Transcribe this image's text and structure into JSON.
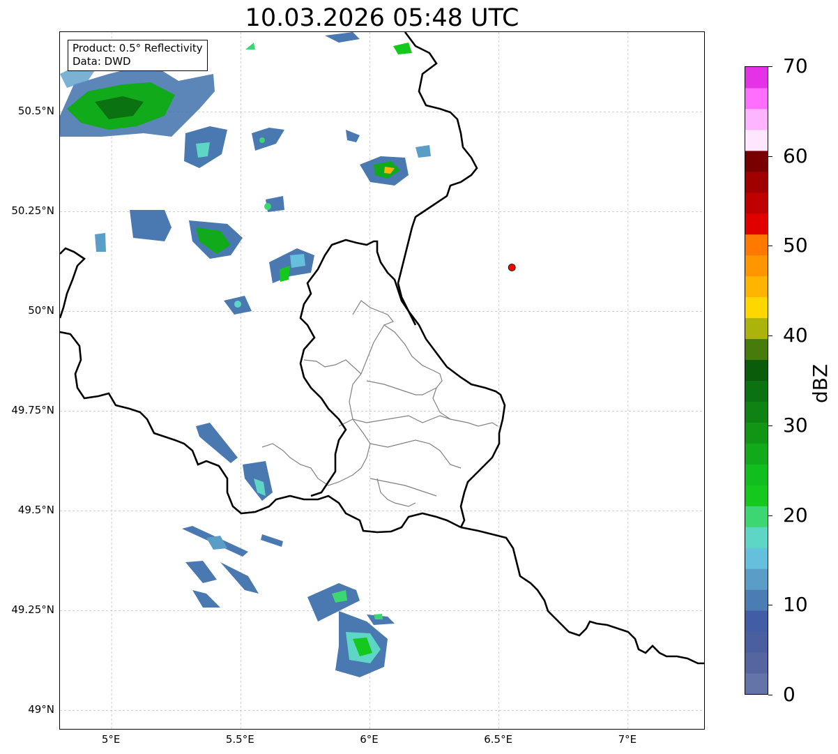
{
  "title": "10.03.2026 05:48 UTC",
  "info_box": {
    "product": "Product: 0.5° Reflectivity",
    "data": "Data: DWD"
  },
  "map": {
    "extent": {
      "lon_min": 4.8,
      "lon_max": 7.3,
      "lat_min": 48.95,
      "lat_max": 50.7
    },
    "lat_ticks": [
      {
        "value": 50.5,
        "label": "50.5°N"
      },
      {
        "value": 50.25,
        "label": "50.25°N"
      },
      {
        "value": 50.0,
        "label": "50°N"
      },
      {
        "value": 49.75,
        "label": "49.75°N"
      },
      {
        "value": 49.5,
        "label": "49.5°N"
      },
      {
        "value": 49.25,
        "label": "49.25°N"
      },
      {
        "value": 49.0,
        "label": "49°N"
      }
    ],
    "lon_ticks": [
      {
        "value": 5.0,
        "label": "5°E"
      },
      {
        "value": 5.5,
        "label": "5.5°E"
      },
      {
        "value": 6.0,
        "label": "6°E"
      },
      {
        "value": 6.5,
        "label": "6.5°E"
      },
      {
        "value": 7.0,
        "label": "7°E"
      }
    ],
    "radar_site": {
      "lon": 6.55,
      "lat": 50.11,
      "color": "#ff0000"
    },
    "gridlines": true
  },
  "colorbar": {
    "unit": "dBZ",
    "min": 0,
    "max": 70,
    "step": 2.5,
    "colors": [
      "#6473a8",
      "#5565a0",
      "#4a5fa0",
      "#425da6",
      "#4c7cb4",
      "#5a9ec8",
      "#64c0dc",
      "#5ed6c6",
      "#3cd672",
      "#14c81e",
      "#10be1e",
      "#10aa1a",
      "#109614",
      "#0e8212",
      "#0a7210",
      "#0a5c0a",
      "#487c0a",
      "#aab40a",
      "#ffd700",
      "#ffb400",
      "#ff9600",
      "#ff7800",
      "#e10000",
      "#c00000",
      "#a00000",
      "#780000",
      "#ffe6ff",
      "#ffb4ff",
      "#ff6eff",
      "#e632e6"
    ],
    "ticks": [
      {
        "value": 0,
        "label": "0"
      },
      {
        "value": 10,
        "label": "10"
      },
      {
        "value": 20,
        "label": "20"
      },
      {
        "value": 30,
        "label": "30"
      },
      {
        "value": 40,
        "label": "40"
      },
      {
        "value": 50,
        "label": "50"
      },
      {
        "value": 60,
        "label": "60"
      },
      {
        "value": 70,
        "label": "70"
      }
    ]
  },
  "echo_areas": [
    {
      "lon": 4.98,
      "lat": 50.52,
      "dbz": 25
    },
    {
      "lon": 5.12,
      "lat": 50.55,
      "dbz": 28
    },
    {
      "lon": 5.25,
      "lat": 50.48,
      "dbz": 20
    },
    {
      "lon": 5.45,
      "lat": 50.42,
      "dbz": 10
    },
    {
      "lon": 5.64,
      "lat": 50.45,
      "dbz": 12
    },
    {
      "lon": 6.07,
      "lat": 50.36,
      "dbz": 35
    },
    {
      "lon": 5.62,
      "lat": 50.27,
      "dbz": 12
    },
    {
      "lon": 5.17,
      "lat": 50.22,
      "dbz": 6
    },
    {
      "lon": 5.42,
      "lat": 50.2,
      "dbz": 25
    },
    {
      "lon": 5.7,
      "lat": 50.13,
      "dbz": 14
    },
    {
      "lon": 5.46,
      "lat": 50.02,
      "dbz": 10
    },
    {
      "lon": 5.42,
      "lat": 49.71,
      "dbz": 8
    },
    {
      "lon": 5.61,
      "lat": 49.58,
      "dbz": 12
    },
    {
      "lon": 5.47,
      "lat": 49.42,
      "dbz": 10
    },
    {
      "lon": 5.38,
      "lat": 49.31,
      "dbz": 10
    },
    {
      "lon": 5.95,
      "lat": 49.28,
      "dbz": 14
    },
    {
      "lon": 6.0,
      "lat": 49.15,
      "dbz": 20
    }
  ]
}
